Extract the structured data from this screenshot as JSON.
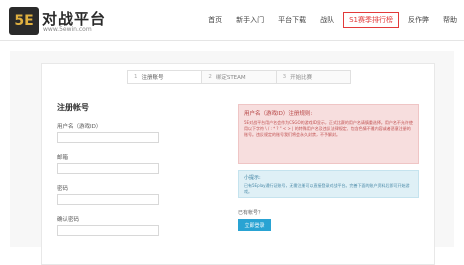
{
  "header": {
    "logo_badge": "5E",
    "logo_title": "对战平台",
    "logo_url": "www.5ewin.com",
    "nav": [
      {
        "label": "首页",
        "active": false
      },
      {
        "label": "新手入门",
        "active": false
      },
      {
        "label": "平台下载",
        "active": false
      },
      {
        "label": "战队",
        "active": false
      },
      {
        "label": "S1赛季排行榜",
        "active": true
      },
      {
        "label": "反作弊",
        "active": false
      },
      {
        "label": "帮助",
        "active": false
      }
    ],
    "accent_color": "#e23a3a"
  },
  "steps": [
    {
      "num": "1",
      "label": "注册账号",
      "current": true
    },
    {
      "num": "2",
      "label": "绑定STEAM",
      "current": false
    },
    {
      "num": "3",
      "label": "开始比赛",
      "current": false
    }
  ],
  "form": {
    "title": "注册帐号",
    "fields": [
      {
        "label": "用户名（游戏ID）",
        "value": ""
      },
      {
        "label": "邮箱",
        "value": ""
      },
      {
        "label": "密码",
        "value": ""
      },
      {
        "label": "确认密码",
        "value": ""
      }
    ]
  },
  "notice_red": {
    "title": "用户名（游戏ID）注册规则:",
    "body": "5E对战平台用户名会作为CSGO的游戏ID显示，正式比赛的用户名请慎重选择。用户名不允许使用以下字符 \\ / : * ? \" < > | 的特殊用户名及违反法律规定、包含色情不雅内容或者恶意注册的账号。违反规定的账号我们将会永久封禁，不予解封。"
  },
  "notice_blue": {
    "title": "小提示:",
    "body": "已有5Eplay通行证账号，无需注册可以直接登录对战平台。完善下面的账户资料后即可开始游戏。"
  },
  "login": {
    "prompt": "已有帐号？",
    "button": "立即登录",
    "button_color": "#29a3d3"
  }
}
